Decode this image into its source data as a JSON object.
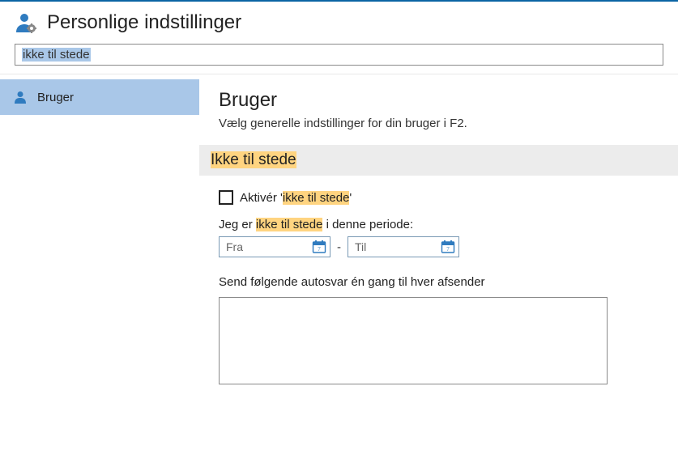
{
  "header": {
    "title": "Personlige indstillinger"
  },
  "search": {
    "value": "ikke til stede"
  },
  "sidebar": {
    "items": [
      {
        "label": "Bruger"
      }
    ]
  },
  "content": {
    "title": "Bruger",
    "subtitle": "Vælg generelle indstillinger for din bruger i F2.",
    "section_title": "Ikke til stede",
    "activate_prefix": "Aktivér '",
    "activate_highlight": "ikke til stede",
    "activate_suffix": "'",
    "period_prefix": "Jeg er ",
    "period_highlight": "ikke til stede",
    "period_suffix": " i denne periode:",
    "from_placeholder": "Fra",
    "to_placeholder": "Til",
    "date_separator": "-",
    "autosvar_label": "Send følgende autosvar én gang til hver afsender"
  }
}
